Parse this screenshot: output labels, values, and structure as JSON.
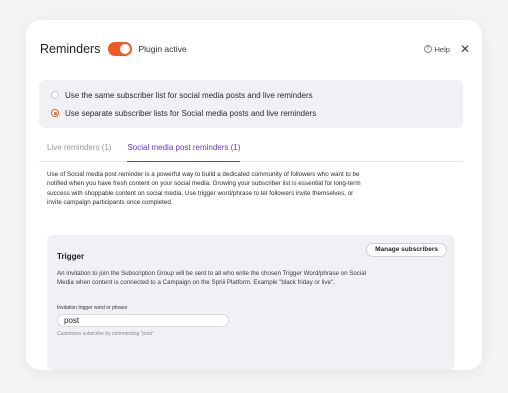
{
  "header": {
    "title": "Reminders",
    "plugin_label": "Plugin active",
    "help_label": "Help"
  },
  "radio_options": [
    {
      "label": "Use the same subscriber list for social media posts and live reminders",
      "selected": false
    },
    {
      "label": "Use separate subscriber lists for Social media posts and live reminders",
      "selected": true
    }
  ],
  "tabs": [
    {
      "label": "Live reminders (1)",
      "active": false
    },
    {
      "label": "Social media post reminders (1)",
      "active": true
    }
  ],
  "description": "Use of Social media post reminder is a powerful way to build a dedicated community of followers who want to be notified when you have fresh content on your social media. Growing your subscriber list is essential for long-term success with shoppable content on social media. Use trigger word/phrase to let followers invite themselves, or invite campaign participants once completed.",
  "trigger": {
    "title": "Trigger",
    "manage_button": "Manage subscribers",
    "text": "An invitation to join the Subscription Group will be sent to all who write the chosen Trigger Word/phrase on Social Media when content is connected to a Campaign on the Spriii Platform. Example \"black friday or live\".",
    "field_label": "Invitation trigger word or phrase",
    "field_value": "post",
    "field_help": "Customers subscribe by commenting \"post\""
  },
  "colors": {
    "accent": "#ef5a24",
    "tab_active": "#6b33d8"
  }
}
